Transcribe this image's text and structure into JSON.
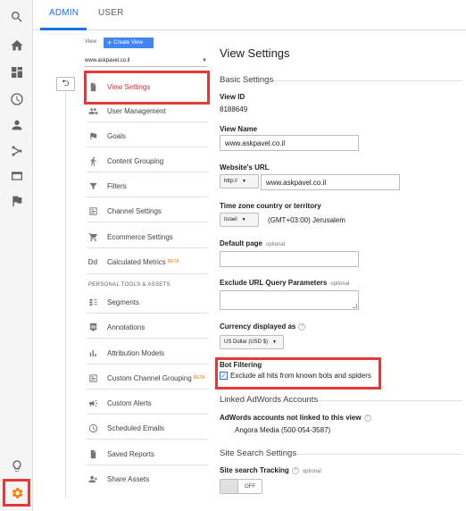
{
  "tabs": {
    "admin": "ADMIN",
    "user": "USER"
  },
  "view_selector": {
    "label": "View",
    "create_button": "Create View",
    "selected_view": "www.askpavel.co.il"
  },
  "sidebar": {
    "items": [
      {
        "label": "View Settings",
        "icon": "document-icon",
        "active": true
      },
      {
        "label": "User Management",
        "icon": "users-icon"
      },
      {
        "label": "Goals",
        "icon": "flag-icon"
      },
      {
        "label": "Content Grouping",
        "icon": "walker-icon"
      },
      {
        "label": "Filters",
        "icon": "filter-icon"
      },
      {
        "label": "Channel Settings",
        "icon": "channel-icon"
      },
      {
        "label": "Ecommerce Settings",
        "icon": "cart-icon"
      },
      {
        "label": "Calculated Metrics",
        "icon": "dd-icon",
        "badge": "BETA"
      }
    ],
    "section_label": "PERSONAL TOOLS & ASSETS",
    "tools": [
      {
        "label": "Segments",
        "icon": "segments-icon"
      },
      {
        "label": "Annotations",
        "icon": "annotation-icon"
      },
      {
        "label": "Attribution Models",
        "icon": "bar-chart-icon"
      },
      {
        "label": "Custom Channel Grouping",
        "icon": "channel-icon",
        "badge": "BETA"
      },
      {
        "label": "Custom Alerts",
        "icon": "megaphone-icon"
      },
      {
        "label": "Scheduled Emails",
        "icon": "clock-icon"
      },
      {
        "label": "Saved Reports",
        "icon": "document-icon"
      },
      {
        "label": "Share Assets",
        "icon": "share-icon"
      }
    ],
    "dd_glyph": "Dd"
  },
  "panel": {
    "title": "View Settings",
    "basic_settings": "Basic Settings",
    "view_id_label": "View ID",
    "view_id": "8188649",
    "view_name_label": "View Name",
    "view_name": "www.askpavel.co.il",
    "website_url_label": "Website's URL",
    "protocol": "http://",
    "website_url": "www.askpavel.co.il",
    "timezone_label": "Time zone country or territory",
    "timezone_country": "Israel",
    "timezone": "(GMT+03:00) Jerusalem",
    "default_page_label": "Default page",
    "optional": "optional",
    "exclude_label": "Exclude URL Query Parameters",
    "currency_label": "Currency displayed as",
    "currency": "US Dollar (USD $)",
    "bot_filtering_label": "Bot Filtering",
    "bot_filtering_checkbox": "Exclude all hits from known bots and spiders",
    "bot_filtering_checked": true,
    "linked_adwords": "Linked AdWords Accounts",
    "adwords_not_linked_label": "AdWords accounts not linked to this view",
    "adwords_account": "Angora Media (500-054-3587)",
    "site_search_settings": "Site Search Settings",
    "site_search_tracking_label": "Site search Tracking",
    "site_search_toggle": "OFF"
  },
  "colors": {
    "accent": "#1a73e8",
    "highlight": "#e53935",
    "gear": "#f57c00"
  }
}
